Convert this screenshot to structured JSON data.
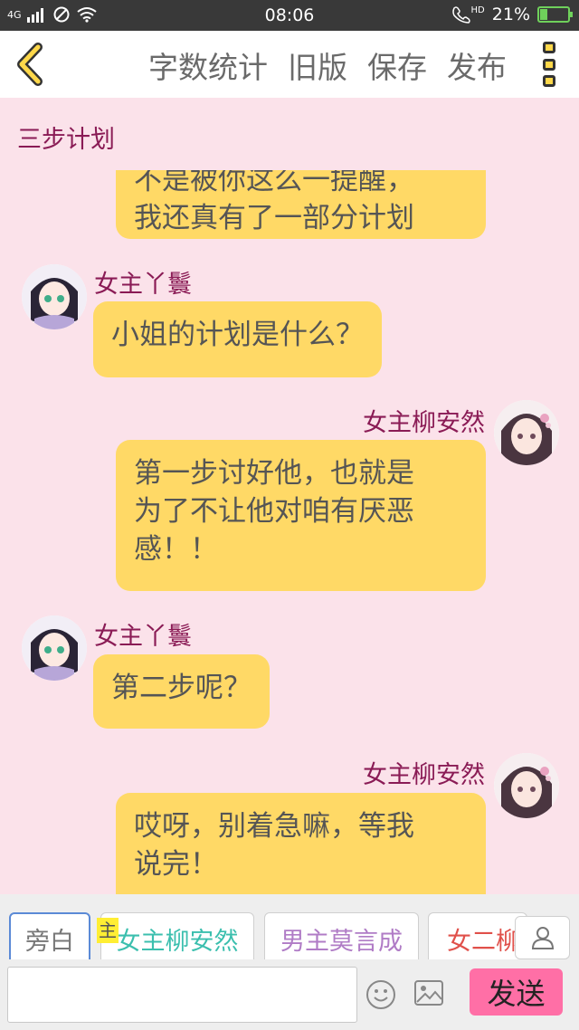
{
  "status": {
    "network": "4G",
    "time": "08:06",
    "hd": "HD",
    "battery": "21%"
  },
  "toolbar": {
    "actions": [
      "字数统计",
      "旧版",
      "保存",
      "发布"
    ]
  },
  "chapter_title": "三步计划",
  "chat": {
    "messages": [
      {
        "speaker": "",
        "side": "right",
        "text": "不是被你这么一提醒，\n我还真有了一部分计划"
      },
      {
        "speaker": "女主丫鬟",
        "side": "left",
        "text": "小姐的计划是什么？"
      },
      {
        "speaker": "女主柳安然",
        "side": "right",
        "text": "第一步讨好他，也就是\n为了不让他对咱有厌恶\n感！！"
      },
      {
        "speaker": "女主丫鬟",
        "side": "left",
        "text": "第二步呢？"
      },
      {
        "speaker": "女主柳安然",
        "side": "right",
        "text": "哎呀，别着急嘛，等我\n说完！"
      }
    ]
  },
  "roles": {
    "items": [
      {
        "label": "旁白",
        "color": "#777777"
      },
      {
        "label": "女主柳安然",
        "color": "#3bbfae"
      },
      {
        "label": "男主莫言成",
        "color": "#b07cc6"
      },
      {
        "label": "女二柳",
        "color": "#e0504a"
      }
    ],
    "marker": "主"
  },
  "input": {
    "placeholder": "",
    "send_label": "发送"
  },
  "colors": {
    "bubble": "#ffd966",
    "background": "#fbe2ea",
    "name": "#8a1b55",
    "send": "#ff6fa6"
  }
}
